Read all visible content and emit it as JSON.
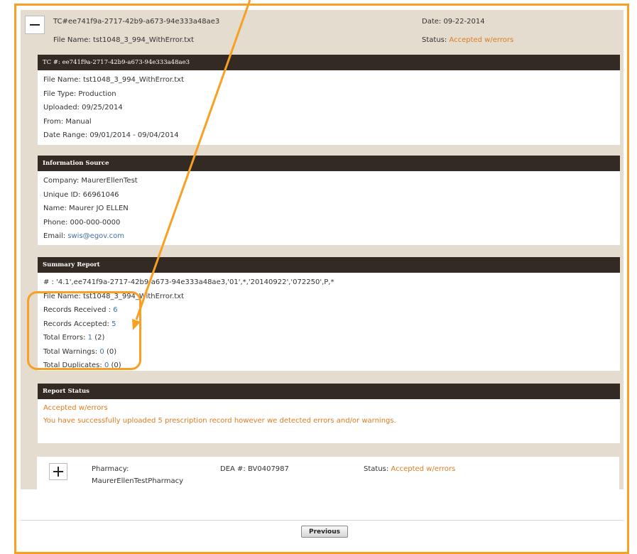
{
  "header": {
    "tc_id": "TC#ee741f9a-2717-42b9-a673-94e333a48ae3",
    "date": "Date: 09-22-2014",
    "file_name": "File Name: tst1048_3_994_WithError.txt",
    "status_label": "Status: ",
    "status_value": "Accepted w/errors"
  },
  "tc_section": {
    "title": "TC #:  ee741f9a-2717-42b9-a673-94e333a48ae3",
    "rows": [
      "File Name: tst1048_3_994_WithError.txt",
      "File Type: Production",
      "Uploaded: 09/25/2014",
      "From: Manual",
      "Date Range: 09/01/2014 - 09/04/2014"
    ]
  },
  "info_section": {
    "title": "Information Source",
    "company": "Company: MaurerEllenTest",
    "unique_id": "Unique ID: 66961046",
    "name": "Name: Maurer JO ELLEN",
    "phone": "Phone: 000-000-0000",
    "email_label": "Email: ",
    "email_value": "swis@egov.com"
  },
  "summary_section": {
    "title": "Summary Report",
    "record_line": "# : '4.1',ee741f9a-2717-42b9-a673-94e333a48ae3,'01',*,'20140922','072250',P,*",
    "file_name": "File Name: tst1048_3_994_WithError.txt",
    "received_label": "Records Received : ",
    "received_value": "6",
    "accepted_label": "Records Accepted: ",
    "accepted_value": "5",
    "errors_label": "Total Errors: ",
    "errors_value": "1",
    "errors_paren": " (2)",
    "warnings_label": "Total Warnings: ",
    "warnings_value": "0",
    "warnings_paren": " (0)",
    "duplicates_label": "Total Duplicates: ",
    "duplicates_value": "0",
    "duplicates_paren": " (0)"
  },
  "report_status": {
    "title": "Report Status",
    "status": "Accepted w/errors",
    "message": "You have successfully uploaded 5 prescription record however we detected errors and/or warnings."
  },
  "pharmacy": {
    "label": "Pharmacy:",
    "name": "MaurerEllenTestPharmacy",
    "dea": "DEA #: BV0407987",
    "status_label": "Status: ",
    "status_value": "Accepted w/errors"
  },
  "footer": {
    "previous_label": "Previous"
  },
  "colors": {
    "accent": "#f7a023",
    "status": "#e07b20",
    "link": "#4070a8",
    "section_header": "#332a23"
  }
}
